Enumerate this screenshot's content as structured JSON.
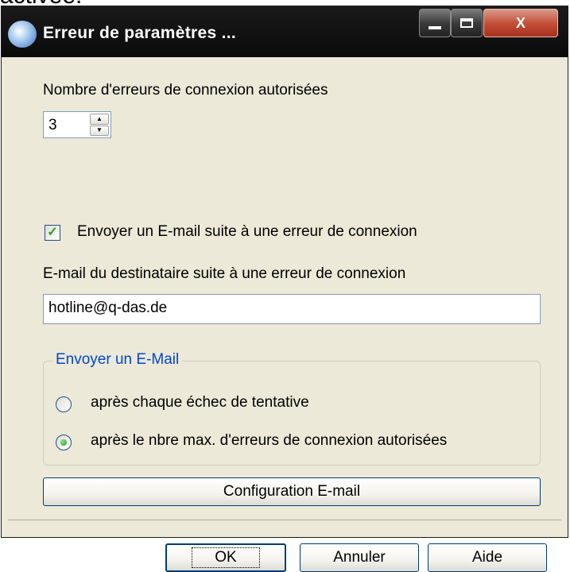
{
  "background_text": "activée.",
  "window": {
    "title": "Erreur de paramètres ...",
    "controls": {
      "close_label": "X"
    }
  },
  "max_errors": {
    "label": "Nombre d'erreurs de connexion autorisées",
    "value": "3"
  },
  "send_email_checkbox": {
    "label": "Envoyer un E-mail suite à une erreur de connexion",
    "checked": true
  },
  "recipient": {
    "label": "E-mail du destinataire suite à une erreur de connexion",
    "value": "hotline@q-das.de"
  },
  "send_group": {
    "title": "Envoyer un E-Mail",
    "options": [
      {
        "label": "après chaque échec de tentative",
        "selected": false
      },
      {
        "label": "après le nbre max. d'erreurs de connexion autorisées",
        "selected": true
      }
    ]
  },
  "config_button": "Configuration E-mail",
  "footer_buttons": {
    "ok": "OK",
    "cancel": "Annuler",
    "help": "Aide"
  },
  "colors": {
    "titlebar": "#141414",
    "dialog_bg": "#ece9d8",
    "group_title": "#0046d5",
    "close_button": "#c4503a",
    "check_mark": "#21a121"
  }
}
